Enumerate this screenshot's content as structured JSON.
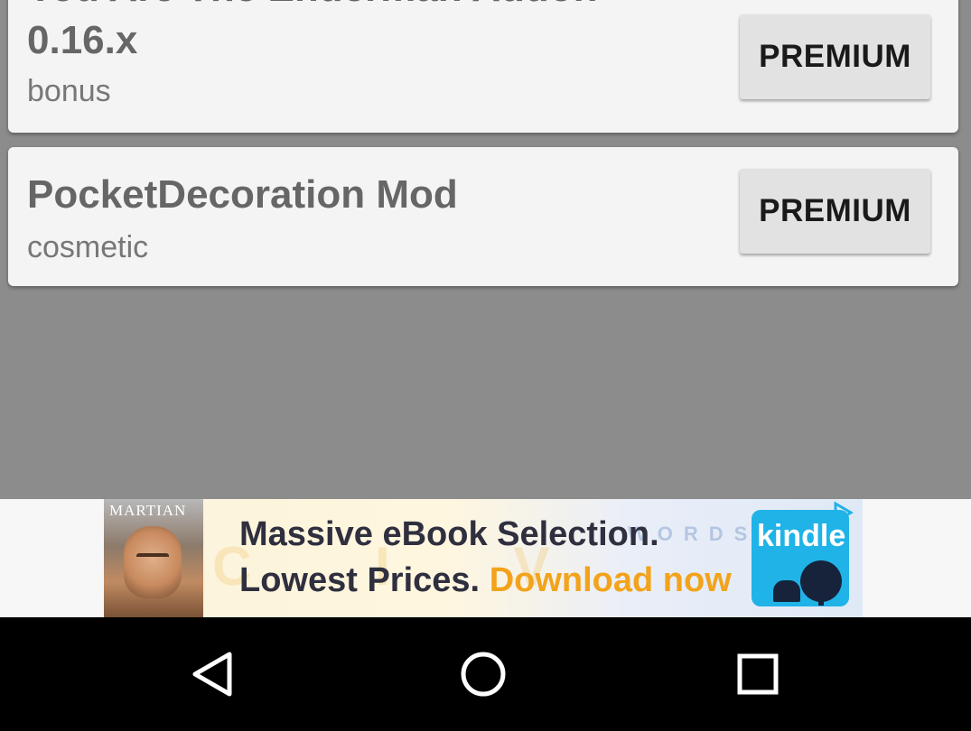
{
  "addons": [
    {
      "title_line1": "You Are The Enderman Addon",
      "title_line2": "0.16.x",
      "category": "bonus",
      "button_label": "PREMIUM"
    },
    {
      "title": "PocketDecoration Mod",
      "category": "cosmetic",
      "button_label": "PREMIUM"
    }
  ],
  "ad": {
    "cover_title": "MARTIAN",
    "line1": "Massive eBook Selection.",
    "line2_plain": "Lowest Prices.",
    "line2_cta": "Download now",
    "brand": "kindle",
    "ad_choices_icon": "ad-choices-icon"
  },
  "navbar": {
    "icons": [
      "back-icon",
      "home-icon",
      "recents-icon"
    ]
  },
  "colors": {
    "background": "#8c8c8c",
    "card": "#f4f4f4",
    "button": "#e2e2e2",
    "cta_orange": "#f3a31b",
    "kindle_blue": "#1fb3e8"
  }
}
